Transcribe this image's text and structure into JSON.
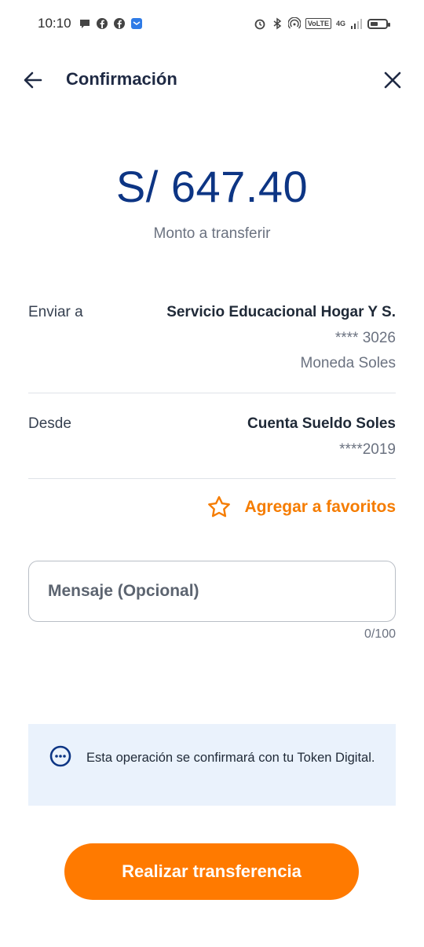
{
  "status_bar": {
    "time": "10:10",
    "volte_label": "VoLTE",
    "network_label": "4G"
  },
  "header": {
    "title": "Confirmación"
  },
  "amount": {
    "value": "S/ 647.40",
    "caption": "Monto a transferir"
  },
  "send_to": {
    "label": "Enviar a",
    "name": "Servicio Educacional Hogar Y S.",
    "account": "**** 3026",
    "currency": "Moneda Soles"
  },
  "from": {
    "label": "Desde",
    "account_name": "Cuenta Sueldo Soles",
    "account_number": "****2019"
  },
  "favorites": {
    "label": "Agregar a favoritos"
  },
  "message": {
    "placeholder": "Mensaje (Opcional)",
    "value": "",
    "counter": "0/100"
  },
  "info": {
    "text": "Esta operación se confirmará con tu Token Digital."
  },
  "cta": {
    "label": "Realizar transferencia"
  },
  "colors": {
    "primary_blue": "#0d3584",
    "accent_orange": "#ff7a00",
    "banner_bg": "#eaf2fc"
  }
}
